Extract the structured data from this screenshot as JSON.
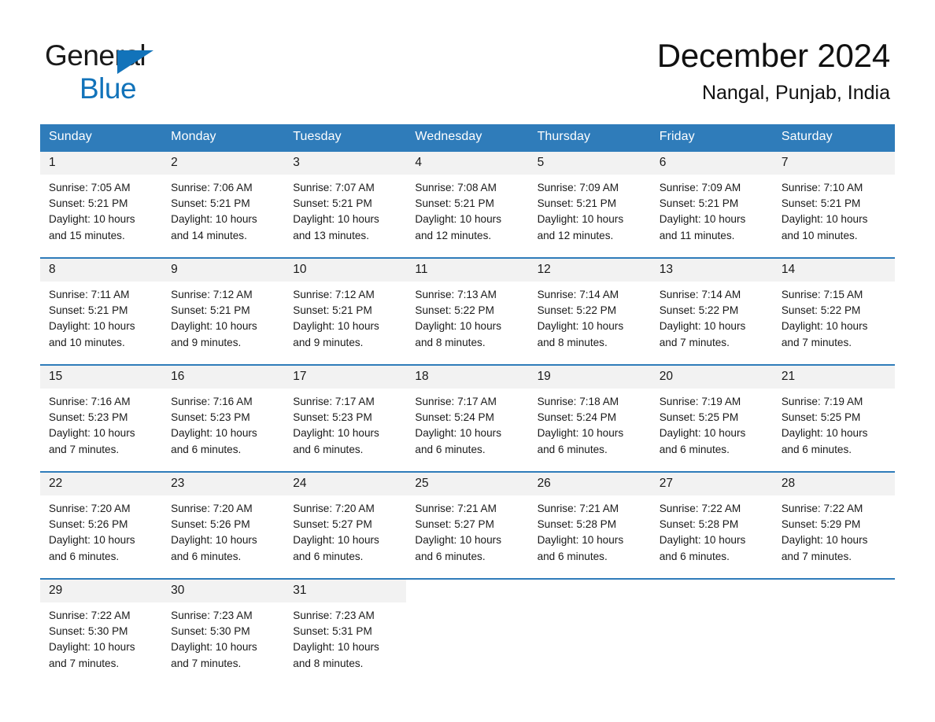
{
  "brand": {
    "line1": "General",
    "line2": "Blue",
    "accent_color": "#1273ba",
    "triangle_icon": "triangle-icon"
  },
  "header": {
    "title": "December 2024",
    "location": "Nangal, Punjab, India"
  },
  "calendar": {
    "header_bg": "#2f7cba",
    "daynum_bg": "#f2f2f2",
    "weekday_labels": [
      "Sunday",
      "Monday",
      "Tuesday",
      "Wednesday",
      "Thursday",
      "Friday",
      "Saturday"
    ],
    "weeks": [
      [
        {
          "day": "1",
          "sunrise": "Sunrise: 7:05 AM",
          "sunset": "Sunset: 5:21 PM",
          "daylight_1": "Daylight: 10 hours",
          "daylight_2": "and 15 minutes."
        },
        {
          "day": "2",
          "sunrise": "Sunrise: 7:06 AM",
          "sunset": "Sunset: 5:21 PM",
          "daylight_1": "Daylight: 10 hours",
          "daylight_2": "and 14 minutes."
        },
        {
          "day": "3",
          "sunrise": "Sunrise: 7:07 AM",
          "sunset": "Sunset: 5:21 PM",
          "daylight_1": "Daylight: 10 hours",
          "daylight_2": "and 13 minutes."
        },
        {
          "day": "4",
          "sunrise": "Sunrise: 7:08 AM",
          "sunset": "Sunset: 5:21 PM",
          "daylight_1": "Daylight: 10 hours",
          "daylight_2": "and 12 minutes."
        },
        {
          "day": "5",
          "sunrise": "Sunrise: 7:09 AM",
          "sunset": "Sunset: 5:21 PM",
          "daylight_1": "Daylight: 10 hours",
          "daylight_2": "and 12 minutes."
        },
        {
          "day": "6",
          "sunrise": "Sunrise: 7:09 AM",
          "sunset": "Sunset: 5:21 PM",
          "daylight_1": "Daylight: 10 hours",
          "daylight_2": "and 11 minutes."
        },
        {
          "day": "7",
          "sunrise": "Sunrise: 7:10 AM",
          "sunset": "Sunset: 5:21 PM",
          "daylight_1": "Daylight: 10 hours",
          "daylight_2": "and 10 minutes."
        }
      ],
      [
        {
          "day": "8",
          "sunrise": "Sunrise: 7:11 AM",
          "sunset": "Sunset: 5:21 PM",
          "daylight_1": "Daylight: 10 hours",
          "daylight_2": "and 10 minutes."
        },
        {
          "day": "9",
          "sunrise": "Sunrise: 7:12 AM",
          "sunset": "Sunset: 5:21 PM",
          "daylight_1": "Daylight: 10 hours",
          "daylight_2": "and 9 minutes."
        },
        {
          "day": "10",
          "sunrise": "Sunrise: 7:12 AM",
          "sunset": "Sunset: 5:21 PM",
          "daylight_1": "Daylight: 10 hours",
          "daylight_2": "and 9 minutes."
        },
        {
          "day": "11",
          "sunrise": "Sunrise: 7:13 AM",
          "sunset": "Sunset: 5:22 PM",
          "daylight_1": "Daylight: 10 hours",
          "daylight_2": "and 8 minutes."
        },
        {
          "day": "12",
          "sunrise": "Sunrise: 7:14 AM",
          "sunset": "Sunset: 5:22 PM",
          "daylight_1": "Daylight: 10 hours",
          "daylight_2": "and 8 minutes."
        },
        {
          "day": "13",
          "sunrise": "Sunrise: 7:14 AM",
          "sunset": "Sunset: 5:22 PM",
          "daylight_1": "Daylight: 10 hours",
          "daylight_2": "and 7 minutes."
        },
        {
          "day": "14",
          "sunrise": "Sunrise: 7:15 AM",
          "sunset": "Sunset: 5:22 PM",
          "daylight_1": "Daylight: 10 hours",
          "daylight_2": "and 7 minutes."
        }
      ],
      [
        {
          "day": "15",
          "sunrise": "Sunrise: 7:16 AM",
          "sunset": "Sunset: 5:23 PM",
          "daylight_1": "Daylight: 10 hours",
          "daylight_2": "and 7 minutes."
        },
        {
          "day": "16",
          "sunrise": "Sunrise: 7:16 AM",
          "sunset": "Sunset: 5:23 PM",
          "daylight_1": "Daylight: 10 hours",
          "daylight_2": "and 6 minutes."
        },
        {
          "day": "17",
          "sunrise": "Sunrise: 7:17 AM",
          "sunset": "Sunset: 5:23 PM",
          "daylight_1": "Daylight: 10 hours",
          "daylight_2": "and 6 minutes."
        },
        {
          "day": "18",
          "sunrise": "Sunrise: 7:17 AM",
          "sunset": "Sunset: 5:24 PM",
          "daylight_1": "Daylight: 10 hours",
          "daylight_2": "and 6 minutes."
        },
        {
          "day": "19",
          "sunrise": "Sunrise: 7:18 AM",
          "sunset": "Sunset: 5:24 PM",
          "daylight_1": "Daylight: 10 hours",
          "daylight_2": "and 6 minutes."
        },
        {
          "day": "20",
          "sunrise": "Sunrise: 7:19 AM",
          "sunset": "Sunset: 5:25 PM",
          "daylight_1": "Daylight: 10 hours",
          "daylight_2": "and 6 minutes."
        },
        {
          "day": "21",
          "sunrise": "Sunrise: 7:19 AM",
          "sunset": "Sunset: 5:25 PM",
          "daylight_1": "Daylight: 10 hours",
          "daylight_2": "and 6 minutes."
        }
      ],
      [
        {
          "day": "22",
          "sunrise": "Sunrise: 7:20 AM",
          "sunset": "Sunset: 5:26 PM",
          "daylight_1": "Daylight: 10 hours",
          "daylight_2": "and 6 minutes."
        },
        {
          "day": "23",
          "sunrise": "Sunrise: 7:20 AM",
          "sunset": "Sunset: 5:26 PM",
          "daylight_1": "Daylight: 10 hours",
          "daylight_2": "and 6 minutes."
        },
        {
          "day": "24",
          "sunrise": "Sunrise: 7:20 AM",
          "sunset": "Sunset: 5:27 PM",
          "daylight_1": "Daylight: 10 hours",
          "daylight_2": "and 6 minutes."
        },
        {
          "day": "25",
          "sunrise": "Sunrise: 7:21 AM",
          "sunset": "Sunset: 5:27 PM",
          "daylight_1": "Daylight: 10 hours",
          "daylight_2": "and 6 minutes."
        },
        {
          "day": "26",
          "sunrise": "Sunrise: 7:21 AM",
          "sunset": "Sunset: 5:28 PM",
          "daylight_1": "Daylight: 10 hours",
          "daylight_2": "and 6 minutes."
        },
        {
          "day": "27",
          "sunrise": "Sunrise: 7:22 AM",
          "sunset": "Sunset: 5:28 PM",
          "daylight_1": "Daylight: 10 hours",
          "daylight_2": "and 6 minutes."
        },
        {
          "day": "28",
          "sunrise": "Sunrise: 7:22 AM",
          "sunset": "Sunset: 5:29 PM",
          "daylight_1": "Daylight: 10 hours",
          "daylight_2": "and 7 minutes."
        }
      ],
      [
        {
          "day": "29",
          "sunrise": "Sunrise: 7:22 AM",
          "sunset": "Sunset: 5:30 PM",
          "daylight_1": "Daylight: 10 hours",
          "daylight_2": "and 7 minutes."
        },
        {
          "day": "30",
          "sunrise": "Sunrise: 7:23 AM",
          "sunset": "Sunset: 5:30 PM",
          "daylight_1": "Daylight: 10 hours",
          "daylight_2": "and 7 minutes."
        },
        {
          "day": "31",
          "sunrise": "Sunrise: 7:23 AM",
          "sunset": "Sunset: 5:31 PM",
          "daylight_1": "Daylight: 10 hours",
          "daylight_2": "and 8 minutes."
        },
        null,
        null,
        null,
        null
      ]
    ]
  }
}
